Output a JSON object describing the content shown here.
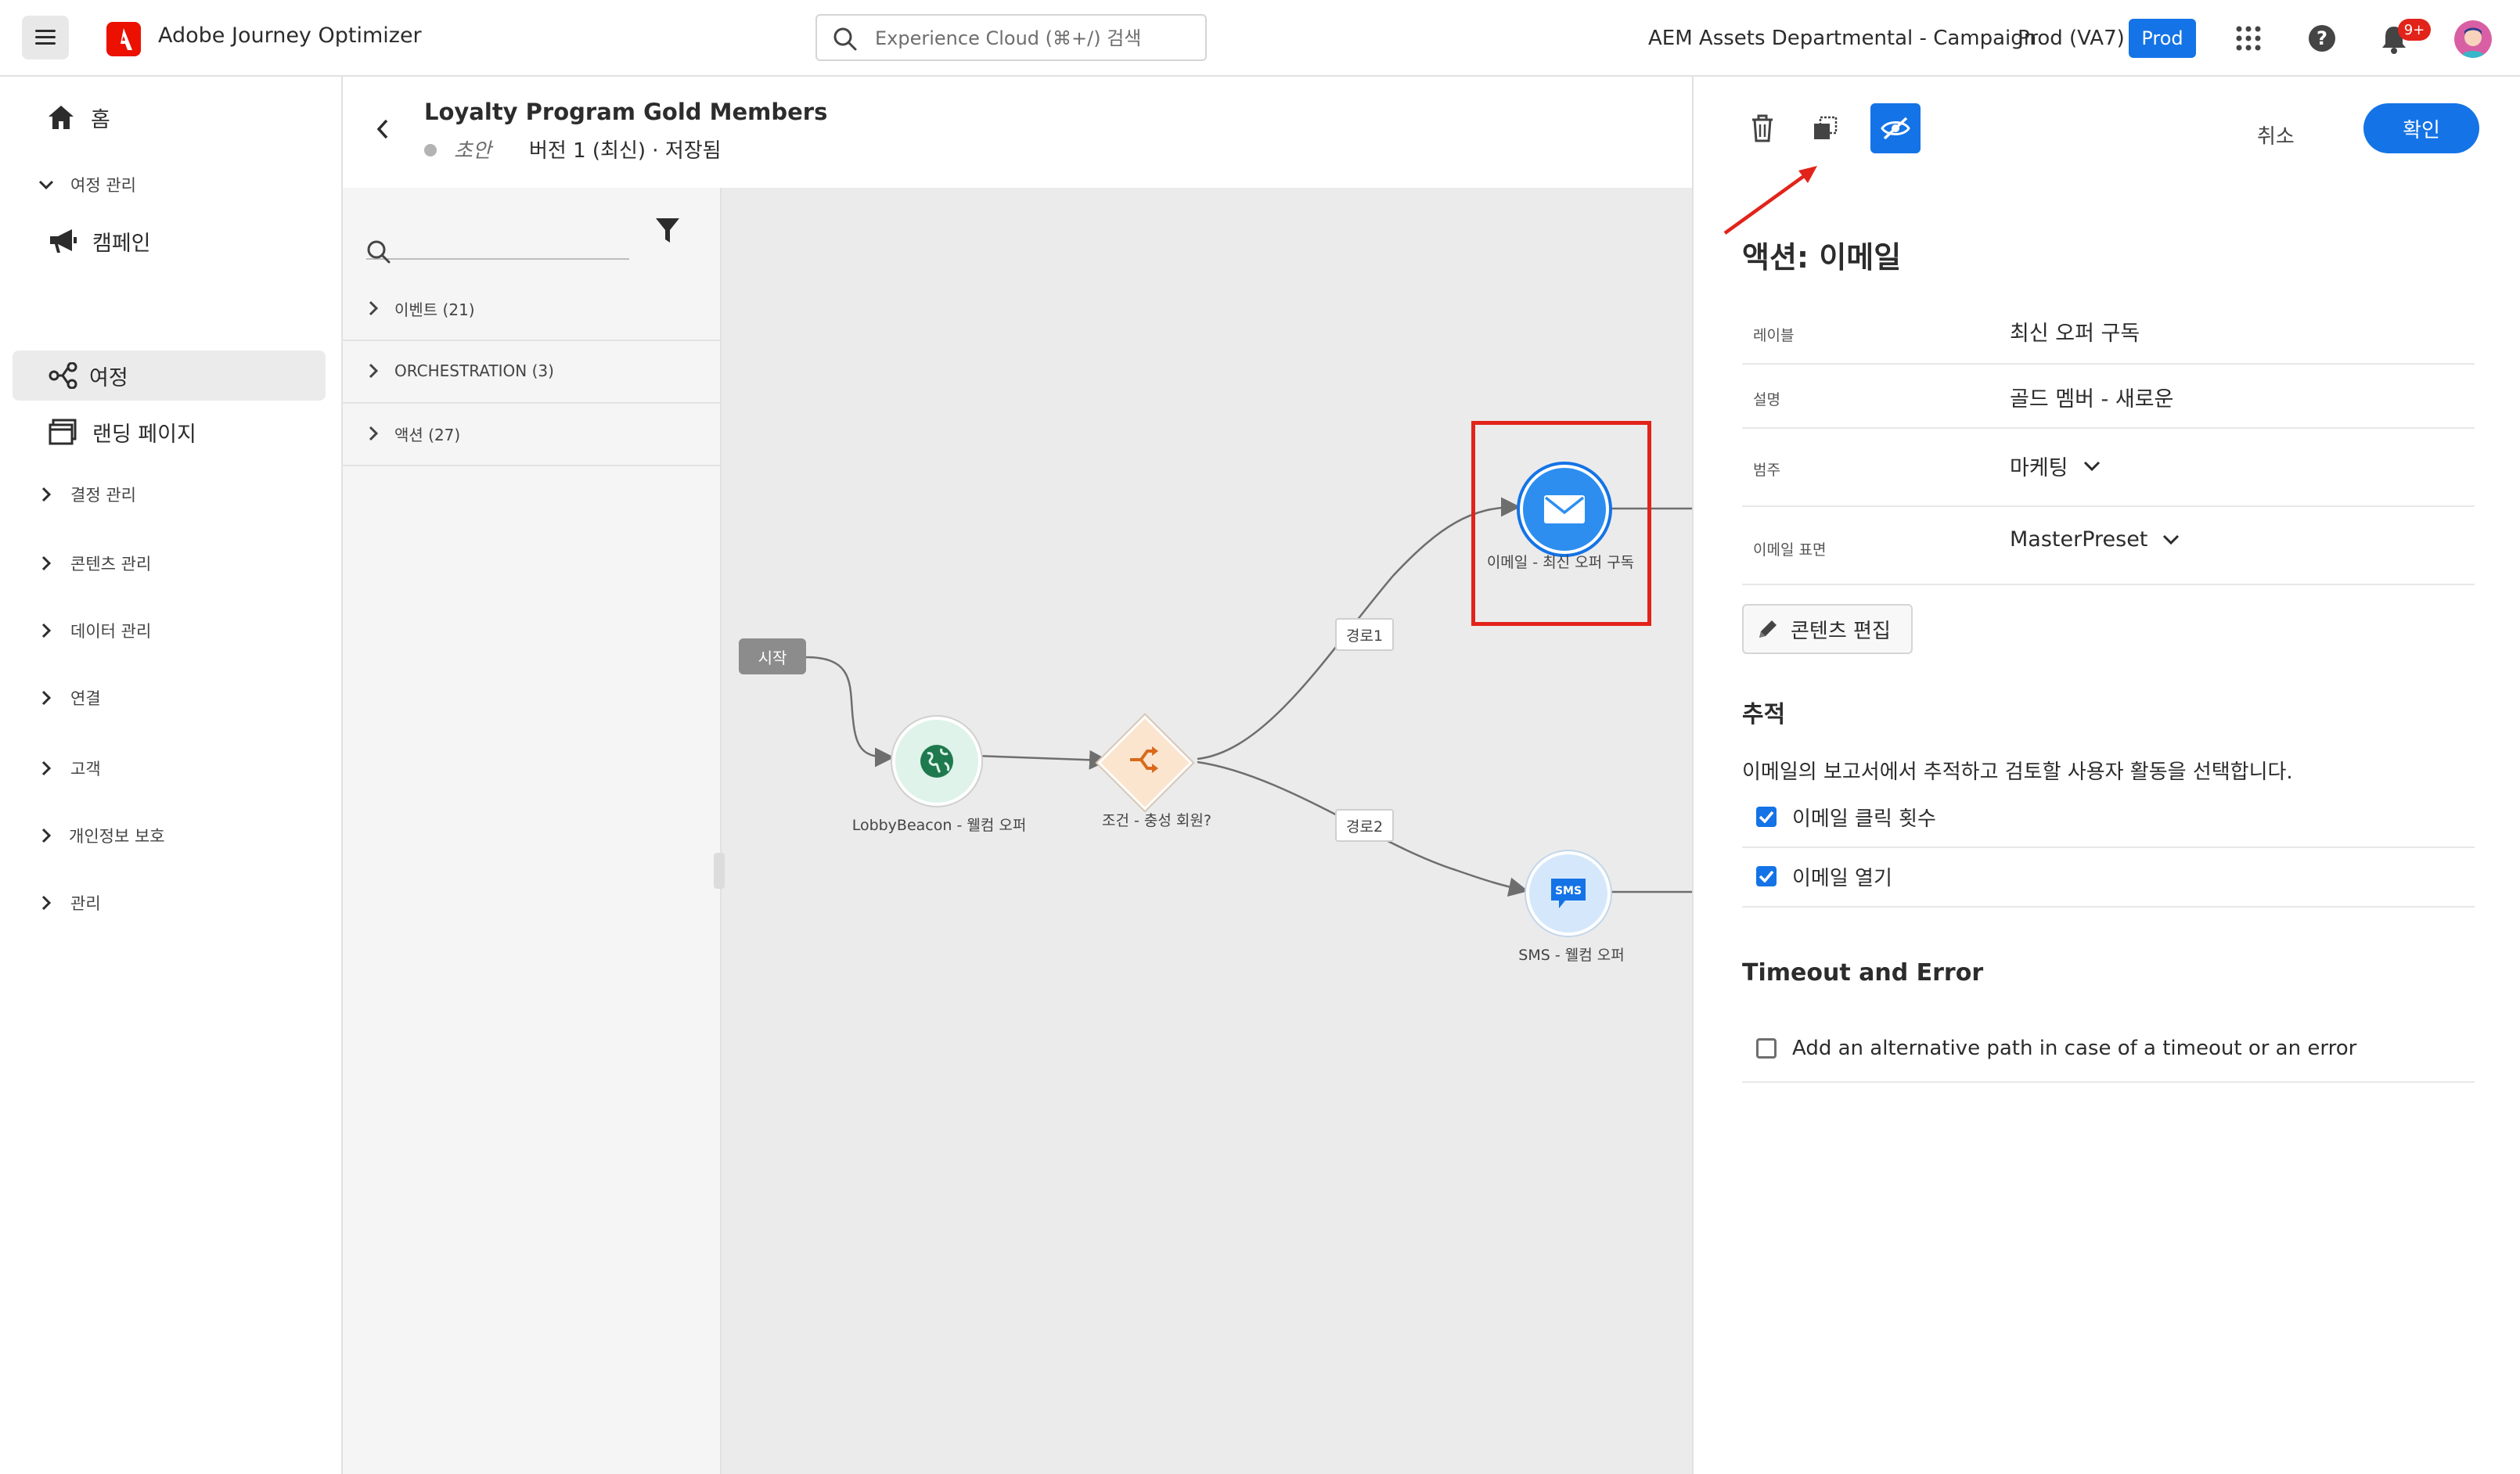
{
  "header": {
    "app_title": "Adobe Journey Optimizer",
    "search_placeholder": "Experience Cloud (⌘+/) 검색",
    "org_name": "AEM Assets Departmental - Campaign",
    "sandbox_name": "Prod (VA7)",
    "sandbox_badge": "Prod",
    "notification_count": "9+",
    "brand_color": "#eb1000",
    "accent_color": "#1473e6"
  },
  "sidebar": {
    "home": "홈",
    "journey_mgmt": "여정 관리",
    "campaigns": "캠페인",
    "journeys": "여정",
    "landing_pages": "랜딩 페이지",
    "decision_mgmt": "결정 관리",
    "content_mgmt": "콘텐츠 관리",
    "data_mgmt": "데이터 관리",
    "connections": "연결",
    "customers": "고객",
    "privacy": "개인정보 보호",
    "admin": "관리"
  },
  "journey": {
    "title": "Loyalty Program Gold Members",
    "status": "초안",
    "version": "버전 1 (최신) · 저장됨"
  },
  "palette": {
    "categories": [
      {
        "label": "이벤트 (21)"
      },
      {
        "label": "ORCHESTRATION (3)"
      },
      {
        "label": "액션 (27)"
      }
    ]
  },
  "canvas": {
    "start": "시작",
    "nodes": {
      "lobby": "LobbyBeacon - 웰컴 오퍼",
      "condition": "조건 - 충성 회원?",
      "email": "이메일 - 최신 오퍼 구독",
      "sms": "SMS - 웰컴 오퍼",
      "sms_glyph": "SMS"
    },
    "paths": {
      "path1": "경로1",
      "path2": "경로2"
    }
  },
  "panel": {
    "cancel": "취소",
    "confirm": "확인",
    "title": "액션: 이메일",
    "fields": {
      "label_key": "레이블",
      "label_val": "최신 오퍼 구독",
      "desc_key": "설명",
      "desc_val": "골드 멤버 - 새로운",
      "category_key": "범주",
      "category_val": "마케팅",
      "surface_key": "이메일 표면",
      "surface_val": "MasterPreset"
    },
    "edit_content": "콘텐츠 편집",
    "tracking": {
      "title": "추적",
      "description": "이메일의 보고서에서 추적하고 검토할 사용자 활동을 선택합니다.",
      "clicks": "이메일 클릭 횟수",
      "opens": "이메일 열기"
    },
    "timeout": {
      "title": "Timeout and Error",
      "option": "Add an alternative path in case of a timeout or an error"
    }
  }
}
